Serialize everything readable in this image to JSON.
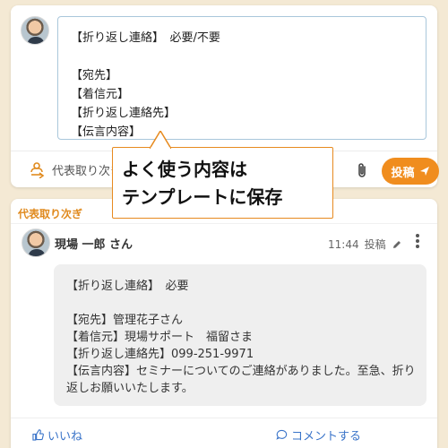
{
  "composer": {
    "draft_lines": [
      "【折り返し連絡】　必要/不要",
      "",
      "【宛先】",
      "【着信元】",
      "【折り返し連絡先】",
      "【伝言内容】"
    ],
    "delegate_label": "代表取り次ぎ",
    "post_label": "投稿"
  },
  "callout": {
    "lines": [
      "よく使う内容は",
      "テンプレートに保存"
    ]
  },
  "post": {
    "category": "代表取り次ぎ",
    "author": "現場 一郎 さん",
    "time": "11:44",
    "status": "投稿",
    "body_lines": [
      "【折り返し連絡】　必要",
      "",
      "【宛先】管理花子さん",
      "【着信元】現場サポート　福留さま",
      "【折り返し連絡先】099-251-9971",
      "【伝言内容】セミナーについてのご連絡がありました。至急、折り",
      "返しお願いいたします。"
    ],
    "like_label": "いいね",
    "comment_label": "コメントする"
  },
  "colors": {
    "accent": "#f08d1e",
    "background": "#f4e9d4",
    "link": "#3a74c9",
    "category": "#e08a1e"
  },
  "icons": [
    "delegate-icon",
    "paperclip-icon",
    "send-icon",
    "pencil-icon",
    "more-vertical-icon",
    "thumbs-up-icon",
    "comment-icon"
  ]
}
